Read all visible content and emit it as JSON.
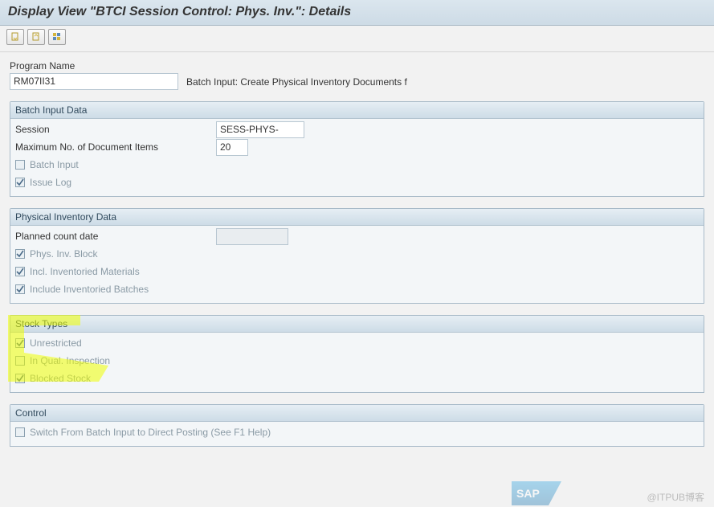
{
  "title": "Display View \"BTCI Session Control: Phys. Inv.\": Details",
  "program": {
    "label": "Program Name",
    "value": "RM07II31",
    "description": "Batch Input: Create Physical Inventory Documents f"
  },
  "groups": {
    "batch_input": {
      "title": "Batch Input Data",
      "session_label": "Session",
      "session_value": "SESS-PHYS-",
      "maxitems_label": "Maximum No. of Document Items",
      "maxitems_value": "20",
      "batch_input_label": "Batch Input",
      "issue_log_label": "Issue Log"
    },
    "phys_inv": {
      "title": "Physical Inventory Data",
      "planned_label": "Planned count date",
      "planned_value": "",
      "block_label": "Phys. Inv. Block",
      "incl_mat_label": "Incl. Inventoried Materials",
      "incl_batch_label": "Include Inventoried Batches"
    },
    "stock_types": {
      "title": "Stock Types",
      "unrestricted_label": "Unrestricted",
      "qual_label": "In Qual. Inspection",
      "blocked_label": "Blocked Stock"
    },
    "control": {
      "title": "Control",
      "switch_label": "Switch From Batch Input to Direct Posting (See F1 Help)"
    }
  },
  "watermark": "@ITPUB博客"
}
